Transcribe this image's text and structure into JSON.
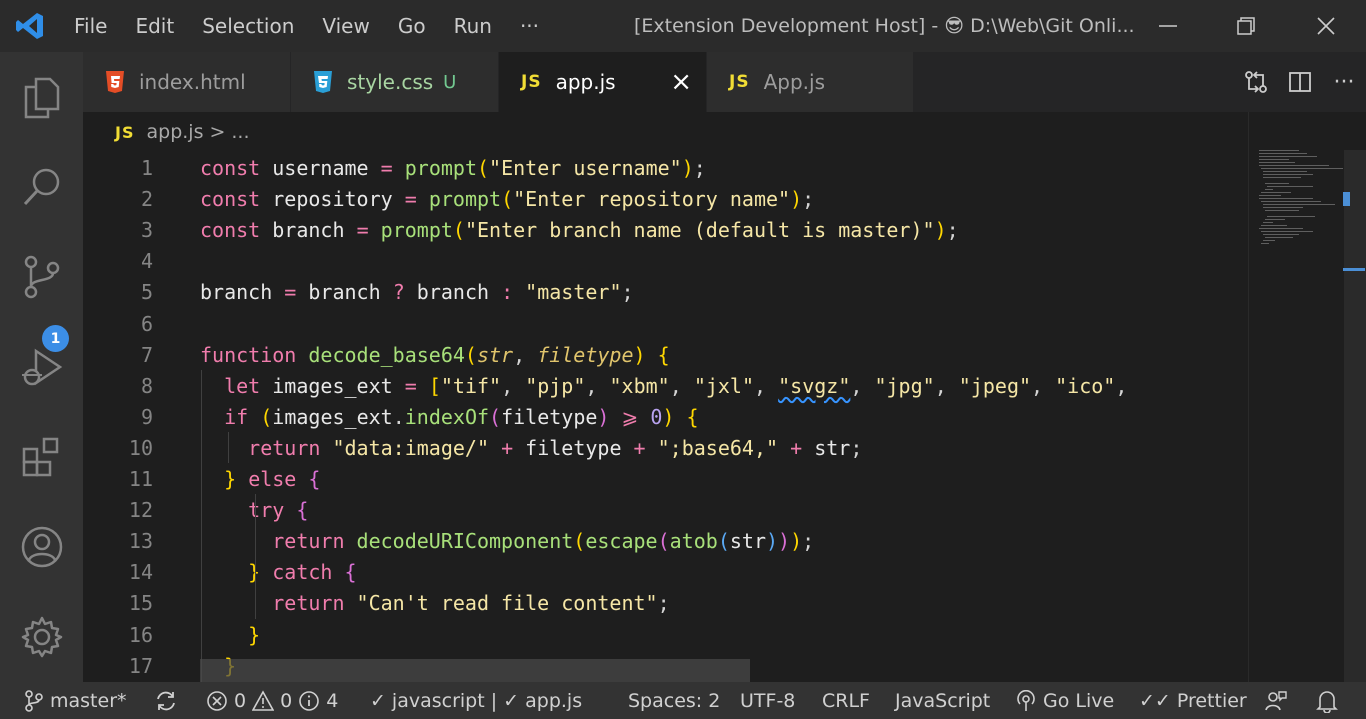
{
  "titlebar": {
    "menu": [
      "File",
      "Edit",
      "Selection",
      "View",
      "Go",
      "Run",
      "···"
    ],
    "title_prefix": "[Extension Development Host] -",
    "title_emoji": "😎",
    "title_path": "D:\\Web\\Git Onli..."
  },
  "activitybar": {
    "icons": [
      "explorer-icon",
      "search-icon",
      "source-control-icon",
      "run-debug-icon",
      "extensions-icon",
      "accounts-icon",
      "settings-gear-icon"
    ],
    "source_control_badge": "1"
  },
  "tabs": [
    {
      "label": "index.html",
      "icon": "html5-icon",
      "status": ""
    },
    {
      "label": "style.css",
      "icon": "css3-icon",
      "status": "U"
    },
    {
      "label": "app.js",
      "icon": "js-icon",
      "status": "",
      "active": true
    },
    {
      "label": "App.js",
      "icon": "js-icon",
      "status": ""
    }
  ],
  "js_icon_text": "JS",
  "breadcrumb": {
    "file": "app.js",
    "separator": ">",
    "rest": "..."
  },
  "editor": {
    "line_numbers": [
      "1",
      "2",
      "3",
      "4",
      "5",
      "6",
      "7",
      "8",
      "9",
      "10",
      "11",
      "12",
      "13",
      "14",
      "15",
      "16",
      "17"
    ],
    "lines": [
      "const username = prompt(\"Enter username\");",
      "const repository = prompt(\"Enter repository name\");",
      "const branch = prompt(\"Enter branch name (default is master)\");",
      "",
      "branch = branch ? branch : \"master\";",
      "",
      "function decode_base64(str, filetype) {",
      "  let images_ext = [\"tif\", \"pjp\", \"xbm\", \"jxl\", \"svgz\", \"jpg\", \"jpeg\", \"ico\",",
      "  if (images_ext.indexOf(filetype) >= 0) {",
      "    return \"data:image/\" + filetype + \";base64,\" + str;",
      "  } else {",
      "    try {",
      "      return decodeURIComponent(escape(atob(str)));",
      "    } catch {",
      "      return \"Can't read file content\";",
      "    }",
      "  }"
    ]
  },
  "statusbar": {
    "branch": "master*",
    "errors": "0",
    "warnings": "0",
    "infos": "4",
    "linters": "javascript | ✓ app.js",
    "spaces": "Spaces: 2",
    "encoding": "UTF-8",
    "eol": "CRLF",
    "language": "JavaScript",
    "golive": "Go Live",
    "prettier": "Prettier"
  }
}
